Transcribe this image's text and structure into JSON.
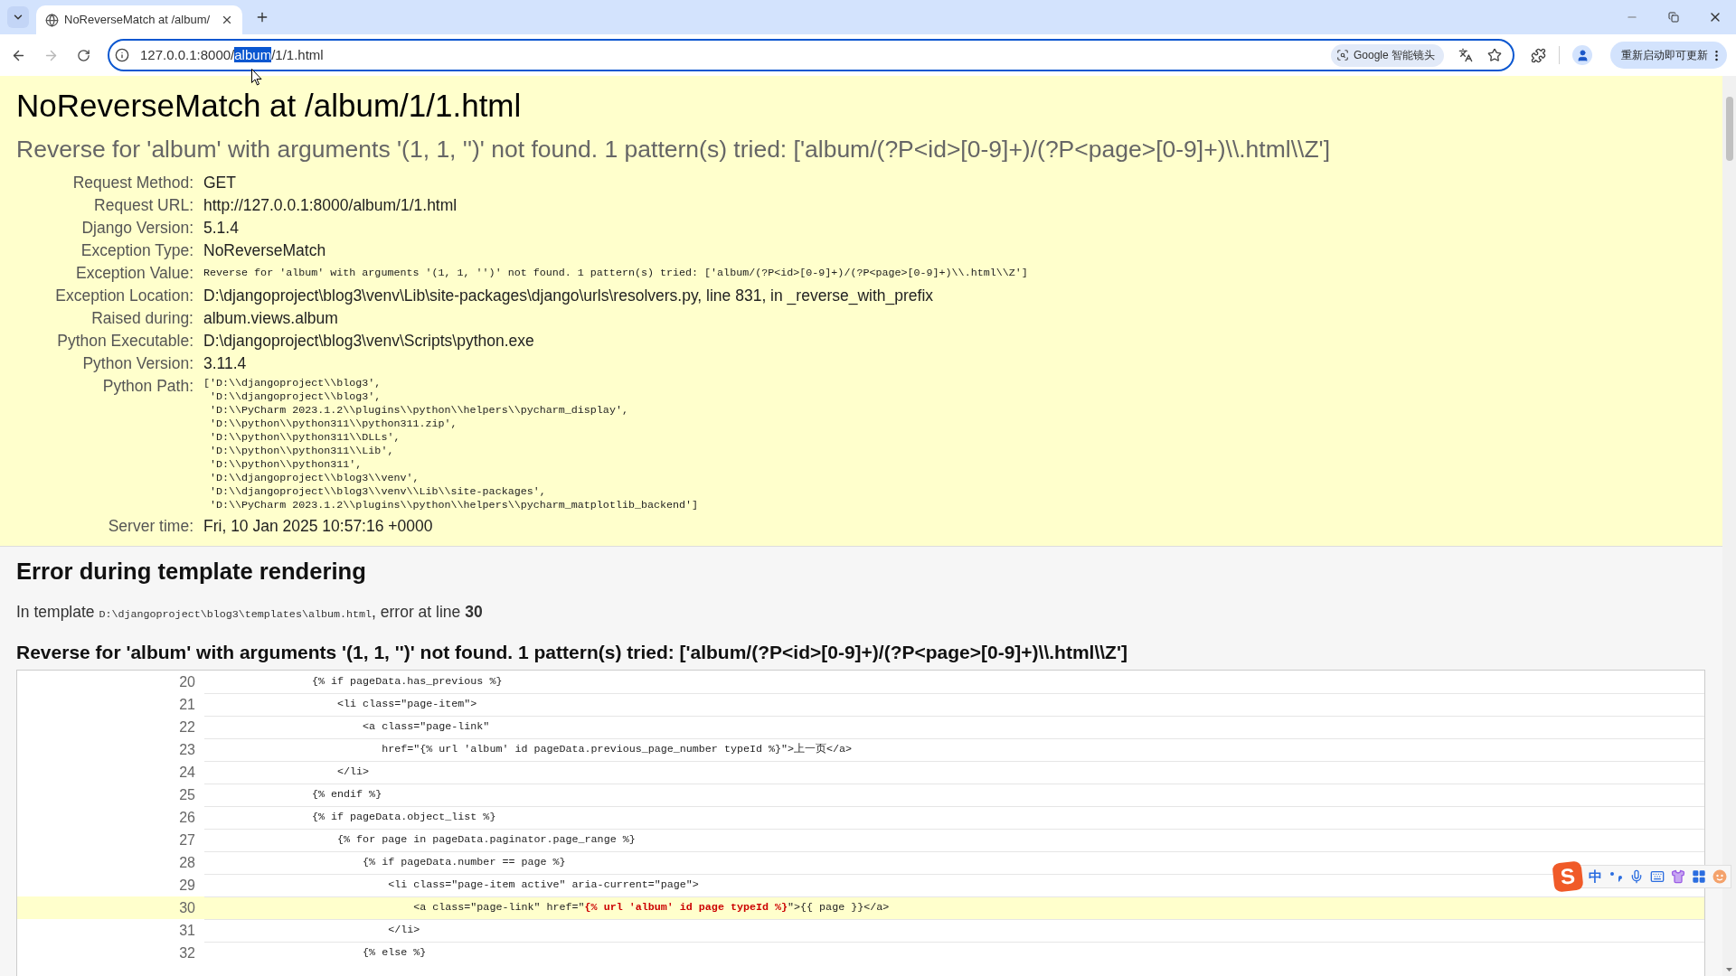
{
  "browser": {
    "tab": {
      "title": "NoReverseMatch at /album/",
      "selected": true
    },
    "forward_enabled": false,
    "address_bar": {
      "url_before": "127.0.0.1:8000/",
      "url_selected": "album",
      "url_after": "/1/1.html"
    },
    "lens_chip": "Google 智能镜头",
    "update_button": "重新启动即可更新"
  },
  "summary": {
    "title": "NoReverseMatch at /album/1/1.html",
    "message": "Reverse for 'album' with arguments '(1, 1, '')' not found. 1 pattern(s) tried: ['album/(?P<id>[0-9]+)/(?P<page>[0-9]+)\\\\.html\\\\Z']",
    "meta": [
      {
        "kind": "text",
        "label": "Request Method:",
        "value": "GET"
      },
      {
        "kind": "text",
        "label": "Request URL:",
        "value": "http://127.0.0.1:8000/album/1/1.html"
      },
      {
        "kind": "text",
        "label": "Django Version:",
        "value": "5.1.4"
      },
      {
        "kind": "text",
        "label": "Exception Type:",
        "value": "NoReverseMatch"
      },
      {
        "kind": "code",
        "label": "Exception Value:",
        "value": "Reverse for 'album' with arguments '(1, 1, '')' not found. 1 pattern(s) tried: ['album/(?P<id>[0-9]+)/(?P<page>[0-9]+)\\\\.html\\\\Z']"
      },
      {
        "kind": "text",
        "label": "Exception Location:",
        "value": "D:\\djangoproject\\blog3\\venv\\Lib\\site-packages\\django\\urls\\resolvers.py, line 831, in _reverse_with_prefix"
      },
      {
        "kind": "text",
        "label": "Raised during:",
        "value": "album.views.album"
      },
      {
        "kind": "text",
        "label": "Python Executable:",
        "value": "D:\\djangoproject\\blog3\\venv\\Scripts\\python.exe"
      },
      {
        "kind": "text",
        "label": "Python Version:",
        "value": "3.11.4"
      },
      {
        "kind": "lines",
        "label": "Python Path:",
        "lines": [
          "['D:\\\\djangoproject\\\\blog3',",
          " 'D:\\\\djangoproject\\\\blog3',",
          " 'D:\\\\PyCharm 2023.1.2\\\\plugins\\\\python\\\\helpers\\\\pycharm_display',",
          " 'D:\\\\python\\\\python311\\\\python311.zip',",
          " 'D:\\\\python\\\\python311\\\\DLLs',",
          " 'D:\\\\python\\\\python311\\\\Lib',",
          " 'D:\\\\python\\\\python311',",
          " 'D:\\\\djangoproject\\\\blog3\\\\venv',",
          " 'D:\\\\djangoproject\\\\blog3\\\\venv\\\\Lib\\\\site-packages',",
          " 'D:\\\\PyCharm 2023.1.2\\\\plugins\\\\python\\\\helpers\\\\pycharm_matplotlib_backend']"
        ]
      },
      {
        "kind": "text",
        "label": "Server time:",
        "value": "Fri, 10 Jan 2025 10:57:16 +0000"
      }
    ]
  },
  "template_error": {
    "title": "Error during template rendering",
    "intro": {
      "before": "In template ",
      "path": "D:\\djangoproject\\blog3\\templates\\album.html",
      "middle": ", error at line ",
      "line": "30"
    },
    "message": "Reverse for 'album' with arguments '(1, 1, '')' not found. 1 pattern(s) tried: ['album/(?P<id>[0-9]+)/(?P<page>[0-9]+)\\\\.html\\\\Z']",
    "lines": [
      {
        "kind": "context",
        "number": "20",
        "code": "{% if pageData.has_previous %}"
      },
      {
        "kind": "context",
        "number": "21",
        "code": "    <li class=\"page-item\">"
      },
      {
        "kind": "context",
        "number": "22",
        "code": "        <a class=\"page-link\""
      },
      {
        "kind": "context",
        "number": "23",
        "code": "           href=\"{% url 'album' id pageData.previous_page_number typeId %}\">上一页</a>"
      },
      {
        "kind": "context",
        "number": "24",
        "code": "    </li>"
      },
      {
        "kind": "context",
        "number": "25",
        "code": "{% endif %}"
      },
      {
        "kind": "context",
        "number": "26",
        "code": "{% if pageData.object_list %}"
      },
      {
        "kind": "context",
        "number": "27",
        "code": "    {% for page in pageData.paginator.page_range %}"
      },
      {
        "kind": "context",
        "number": "28",
        "code": "        {% if pageData.number == page %}"
      },
      {
        "kind": "context",
        "number": "29",
        "code": "            <li class=\"page-item active\" aria-current=\"page\">"
      },
      {
        "kind": "error",
        "number": "30",
        "before": "                <a class=\"page-link\" href=\"",
        "during": "{% url 'album' id page typeId %}",
        "after": "\">{{ page }}</a>"
      },
      {
        "kind": "context",
        "number": "31",
        "code": "            </li>"
      },
      {
        "kind": "context",
        "number": "32",
        "code": "        {% else %}"
      }
    ]
  },
  "ime_toolbar": {
    "logo": "S",
    "mode": "中"
  }
}
